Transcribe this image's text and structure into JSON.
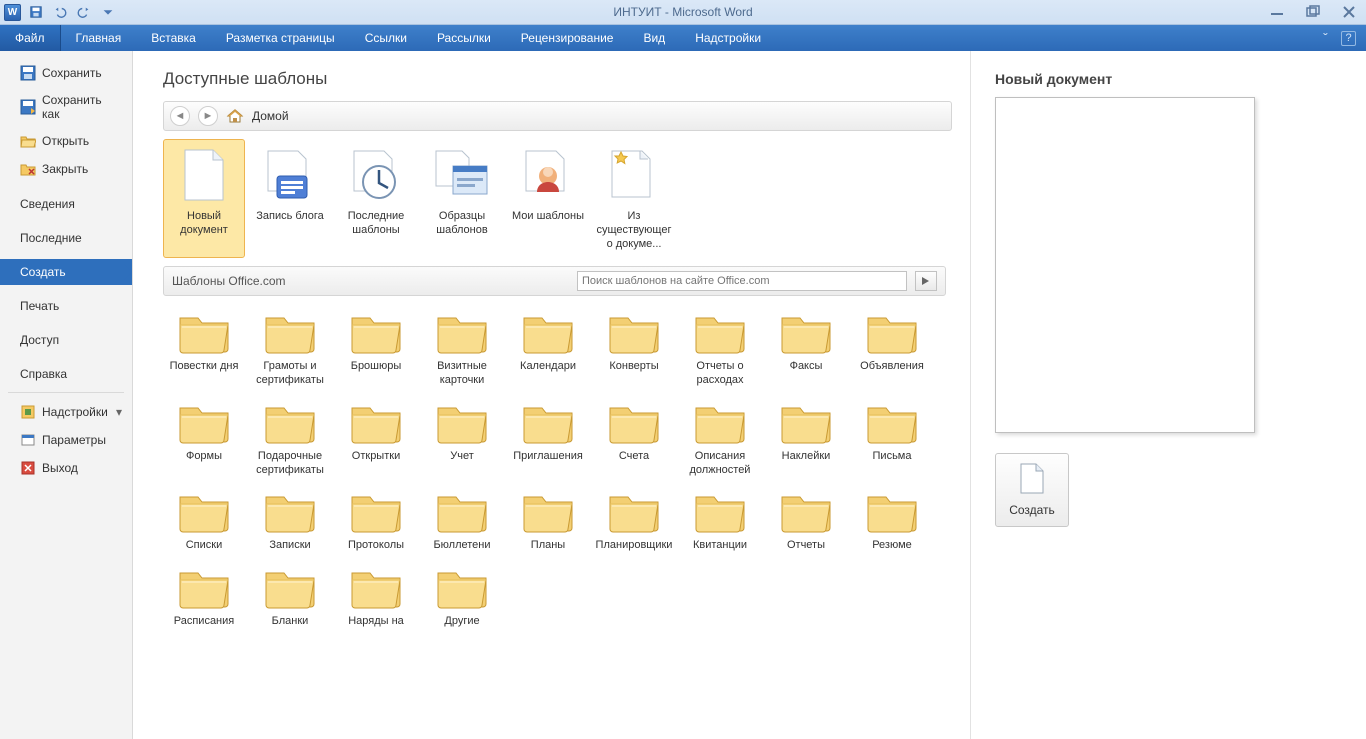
{
  "titlebar": {
    "title": "ИНТУИТ  -  Microsoft Word"
  },
  "ribbon": {
    "tabs": [
      "Файл",
      "Главная",
      "Вставка",
      "Разметка страницы",
      "Ссылки",
      "Рассылки",
      "Рецензирование",
      "Вид",
      "Надстройки"
    ]
  },
  "sidebar": {
    "items_top": [
      {
        "label": "Сохранить"
      },
      {
        "label": "Сохранить как"
      },
      {
        "label": "Открыть"
      },
      {
        "label": "Закрыть"
      }
    ],
    "items_mid": [
      {
        "label": "Сведения"
      },
      {
        "label": "Последние"
      },
      {
        "label": "Создать",
        "active": true
      },
      {
        "label": "Печать"
      },
      {
        "label": "Доступ"
      },
      {
        "label": "Справка"
      }
    ],
    "items_bot": [
      {
        "label": "Надстройки"
      },
      {
        "label": "Параметры"
      },
      {
        "label": "Выход"
      }
    ]
  },
  "main": {
    "heading": "Доступные шаблоны",
    "breadcrumb": "Домой",
    "templates": [
      {
        "label": "Новый документ",
        "selected": true,
        "icon": "doc"
      },
      {
        "label": "Запись блога",
        "icon": "blog"
      },
      {
        "label": "Последние шаблоны",
        "icon": "recent"
      },
      {
        "label": "Образцы шаблонов",
        "icon": "samples"
      },
      {
        "label": "Мои шаблоны",
        "icon": "my"
      },
      {
        "label": "Из существующего докуме...",
        "icon": "existing"
      }
    ],
    "office_section": "Шаблоны Office.com",
    "search_placeholder": "Поиск шаблонов на сайте Office.com",
    "folders": [
      "Повестки дня",
      "Грамоты и сертификаты",
      "Брошюры",
      "Визитные карточки",
      "Календари",
      "Конверты",
      "Отчеты о расходах",
      "Факсы",
      "Объявления",
      "Формы",
      "Подарочные сертификаты",
      "Открытки",
      "Учет",
      "Приглашения",
      "Счета",
      "Описания должностей",
      "Наклейки",
      "Письма",
      "Списки",
      "Записки",
      "Протоколы",
      "Бюллетени",
      "Планы",
      "Планировщики",
      "Квитанции",
      "Отчеты",
      "Резюме",
      "Расписания",
      "Бланки",
      "Наряды на",
      "Другие"
    ]
  },
  "preview": {
    "title": "Новый документ",
    "create_label": "Создать"
  }
}
